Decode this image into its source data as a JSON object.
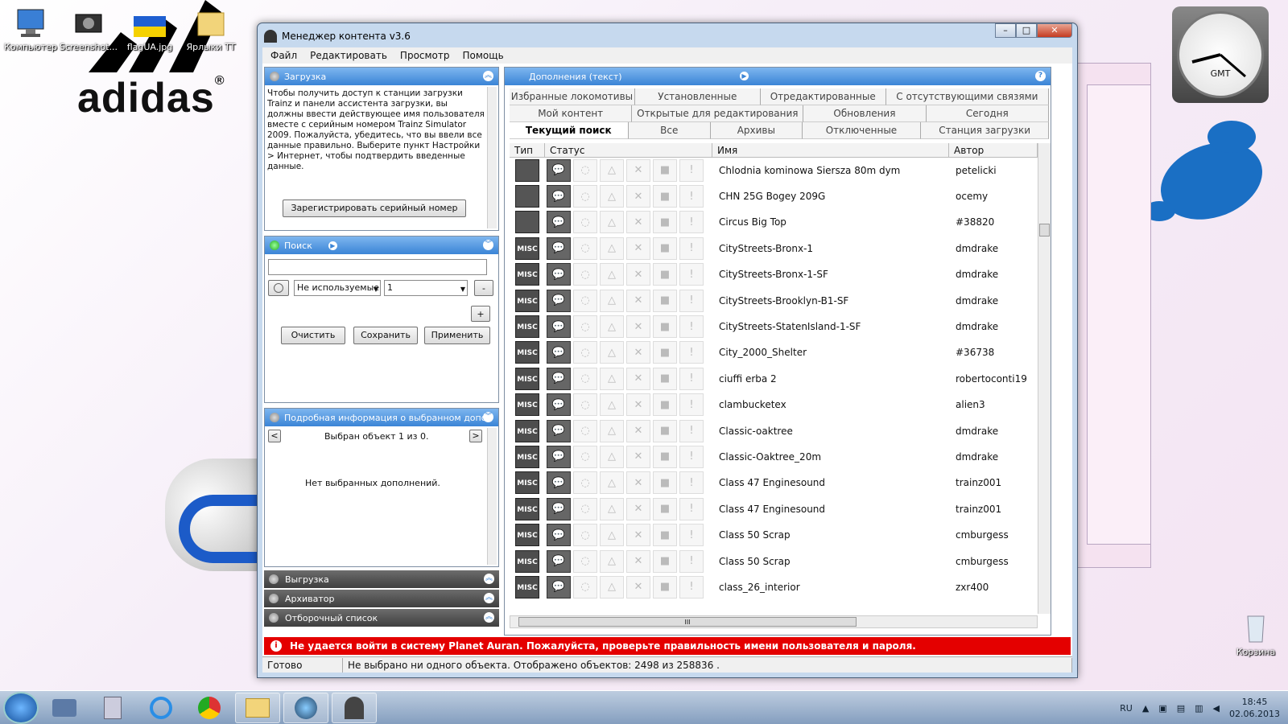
{
  "desktop": {
    "icons": [
      {
        "label": "Компьютер"
      },
      {
        "label": "Screenshot..."
      },
      {
        "label": "flagUA.jpg"
      },
      {
        "label": "Ярлыки ТТ"
      }
    ],
    "logo_text": "adidas",
    "recycle_bin": "Корзина",
    "clock_gadget_label": "GMT"
  },
  "window": {
    "title": "Менеджер контента v3.6",
    "menu": [
      "Файл",
      "Редактировать",
      "Просмотр",
      "Помощь"
    ]
  },
  "download_panel": {
    "title": "Загрузка",
    "text": "Чтобы получить доступ к станции загрузки Trainz и панели ассистента загрузки, вы должны ввести действующее имя пользователя вместе с серийным номером Trainz Simulator 2009. Пожалуйста, убедитесь, что вы ввели все данные правильно. Выберите пункт Настройки > Интернет, чтобы подтвердить введенные данные.",
    "register_button": "Зарегистрировать серийный номер"
  },
  "search_panel": {
    "title": "Поиск",
    "query_value": "",
    "filter_value": "Не используемые",
    "filter_count": "1",
    "minus_label": "-",
    "plus_label": "+",
    "clear_button": "Очистить",
    "save_button": "Сохранить",
    "apply_button": "Применить"
  },
  "details_panel": {
    "title": "Подробная информация о выбранном дополнении",
    "nav_text": "Выбран объект 1 из 0.",
    "empty_text": "Нет выбранных дополнений.",
    "prev": "<",
    "next": ">"
  },
  "collapsed_panels": [
    "Выгрузка",
    "Архиватор",
    "Отборочный список"
  ],
  "content_panel": {
    "title": "Дополнения (текст)",
    "help": "?",
    "tabs_row1": [
      "Избранные локомотивы",
      "Установленные",
      "Отредактированные",
      "С отсутствующими связями"
    ],
    "tabs_row2": [
      "Мой контент",
      "Открытые для редактирования",
      "Обновления",
      "Сегодня"
    ],
    "tabs_row3": [
      "Текущий поиск",
      "Все",
      "Архивы",
      "Отключенные",
      "Станция загрузки"
    ],
    "active_tab": "Текущий поиск",
    "columns": [
      "Тип",
      "Статус",
      "Имя",
      "Автор"
    ],
    "rows": [
      {
        "type": "",
        "type_icon": "buildings-icon",
        "name": "Chlodnia kominowa Siersza 80m dym",
        "author": "petelicki"
      },
      {
        "type": "",
        "type_icon": "bogey-icon",
        "name": "CHN 25G Bogey 209G",
        "author": "ocemy"
      },
      {
        "type": "",
        "type_icon": "house-icon",
        "name": "Circus Big Top",
        "author": "#38820"
      },
      {
        "type": "MISC",
        "name": "CityStreets-Bronx-1",
        "author": "dmdrake"
      },
      {
        "type": "MISC",
        "name": "CityStreets-Bronx-1-SF",
        "author": "dmdrake"
      },
      {
        "type": "MISC",
        "name": "CityStreets-Brooklyn-B1-SF",
        "author": "dmdrake"
      },
      {
        "type": "MISC",
        "name": "CityStreets-StatenIsland-1-SF",
        "author": "dmdrake"
      },
      {
        "type": "MISC",
        "name": "City_2000_Shelter",
        "author": "#36738"
      },
      {
        "type": "MISC",
        "name": "ciuffi erba 2",
        "author": "robertoconti19"
      },
      {
        "type": "MISC",
        "name": "clambucketex",
        "author": "alien3"
      },
      {
        "type": "MISC",
        "name": "Classic-oaktree",
        "author": "dmdrake"
      },
      {
        "type": "MISC",
        "name": "Classic-Oaktree_20m",
        "author": "dmdrake"
      },
      {
        "type": "MISC",
        "name": "Class 47 Enginesound",
        "author": "trainz001"
      },
      {
        "type": "MISC",
        "name": "Class 47 Enginesound",
        "author": "trainz001"
      },
      {
        "type": "MISC",
        "name": "Class 50 Scrap",
        "author": "cmburgess"
      },
      {
        "type": "MISC",
        "name": "Class 50 Scrap",
        "author": "cmburgess"
      },
      {
        "type": "MISC",
        "name": "class_26_interior",
        "author": "zxr400"
      }
    ],
    "hscroll_grip": "III"
  },
  "error_bar": {
    "icon": "i",
    "text": "Не удается войти в систему Planet Auran. Пожалуйста, проверьте правильность имени пользователя и пароля."
  },
  "status_bar": {
    "state": "Готово",
    "info": "Не выбрано ни одного объекта. Отображено объектов: 2498 из 258836 ."
  },
  "taskbar": {
    "lang": "RU",
    "time": "18:45",
    "date": "02.06.2013"
  },
  "colors": {
    "error": "#e40000",
    "panel_header": "#3a84d6",
    "splash": "#1a6fc4"
  }
}
